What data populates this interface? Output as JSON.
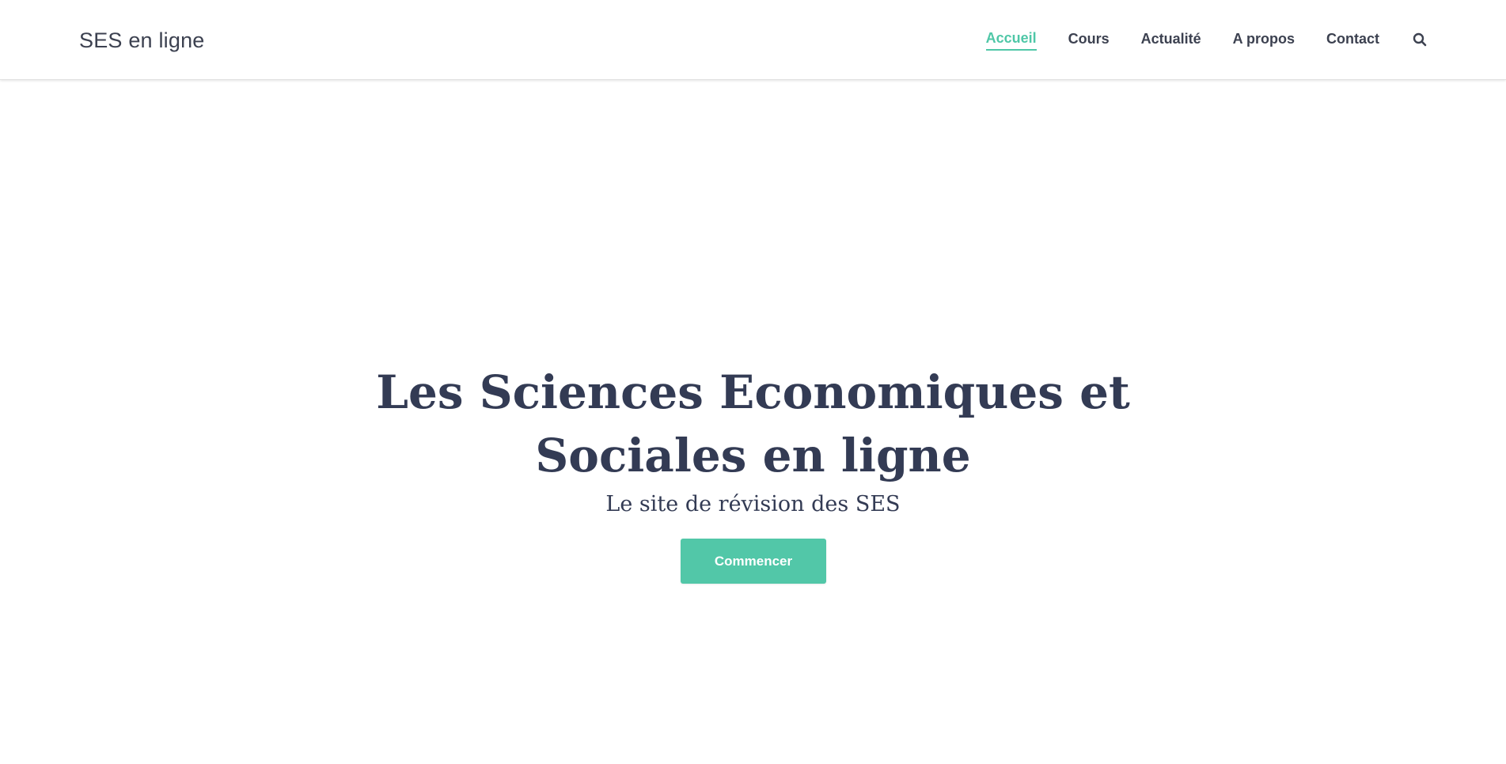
{
  "header": {
    "brand": "SES en ligne",
    "nav": [
      {
        "label": "Accueil",
        "active": true
      },
      {
        "label": "Cours",
        "active": false
      },
      {
        "label": "Actualité",
        "active": false
      },
      {
        "label": "A propos",
        "active": false
      },
      {
        "label": "Contact",
        "active": false
      }
    ],
    "search_icon": "search-icon"
  },
  "hero": {
    "title": "Les Sciences Economiques et Sociales en ligne",
    "subtitle": "Le site de révision des SES",
    "cta_label": "Commencer"
  },
  "colors": {
    "accent": "#52c7a8",
    "text": "#333b54",
    "nav_text": "#3c4150",
    "background": "#ffffff"
  }
}
